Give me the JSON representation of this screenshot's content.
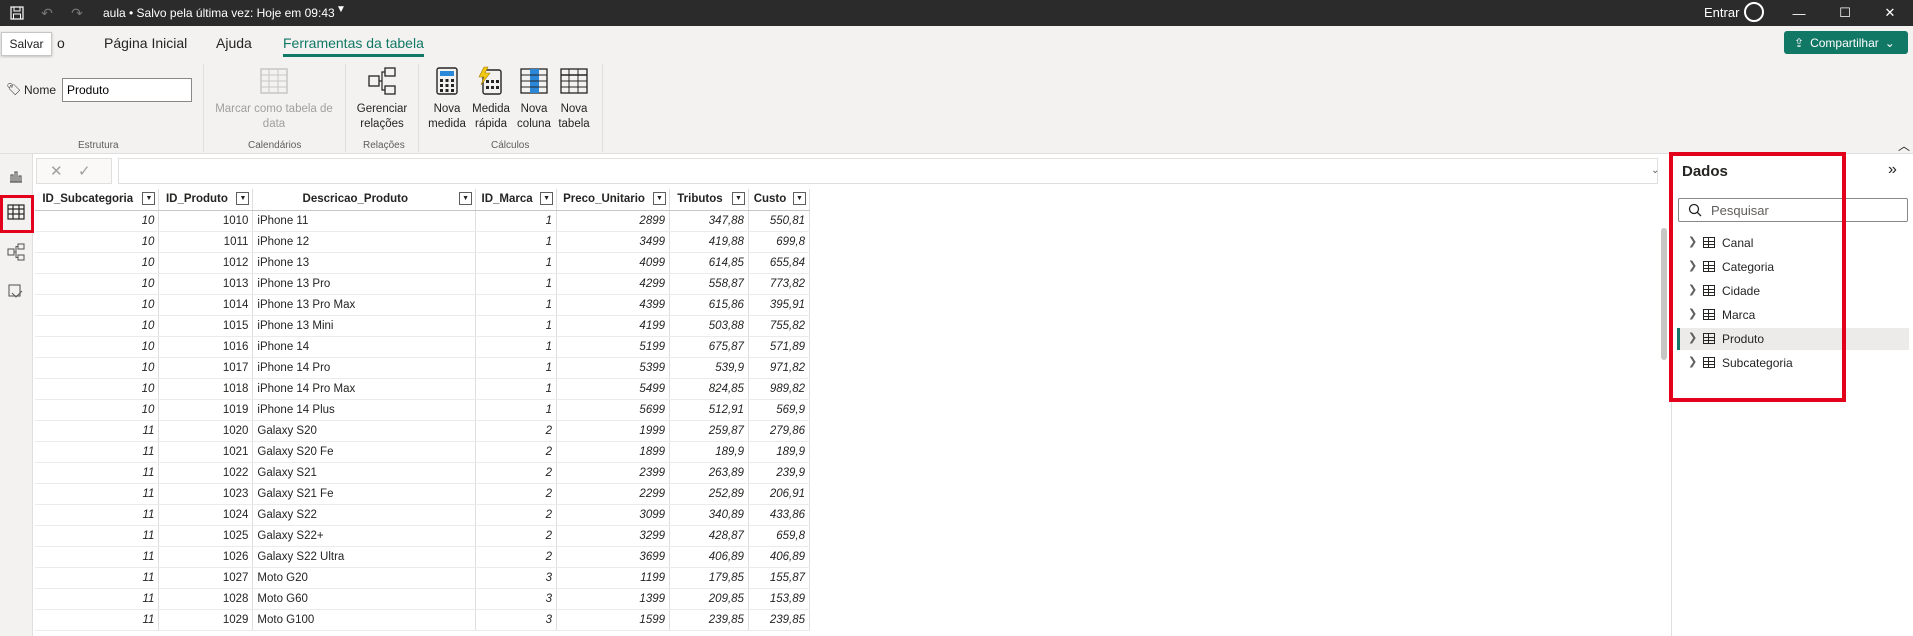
{
  "titlebar": {
    "title": "aula • Salvo pela última vez: Hoje em 09:43",
    "signin": "Entrar"
  },
  "tooltip": "Salvar",
  "tabs": [
    {
      "label": "o"
    },
    {
      "label": "Página Inicial"
    },
    {
      "label": "Ajuda"
    },
    {
      "label": "Ferramentas da tabela"
    }
  ],
  "share": {
    "label": "Compartilhar"
  },
  "ribbon": {
    "name_label": "Nome",
    "name_value": "Produto",
    "groups": {
      "estrutura": "Estrutura",
      "calendarios": "Calendários",
      "relacoes": "Relações",
      "calculos": "Cálculos"
    },
    "buttons": {
      "marcar": "Marcar como tabela de data",
      "gerenciar": "Gerenciar relações",
      "nova_medida": "Nova medida",
      "medida_rapida": "Medida rápida",
      "nova_coluna": "Nova coluna",
      "nova_tabela": "Nova tabela"
    }
  },
  "table": {
    "columns": [
      "ID_Subcategoria",
      "ID_Produto",
      "Descricao_Produto",
      "ID_Marca",
      "Preco_Unitario",
      "Tributos",
      "Custo"
    ],
    "rows": [
      [
        "10",
        "1010",
        "iPhone 11",
        "1",
        "2899",
        "347,88",
        "550,81"
      ],
      [
        "10",
        "1011",
        "iPhone 12",
        "1",
        "3499",
        "419,88",
        "699,8"
      ],
      [
        "10",
        "1012",
        "iPhone 13",
        "1",
        "4099",
        "614,85",
        "655,84"
      ],
      [
        "10",
        "1013",
        "iPhone 13 Pro",
        "1",
        "4299",
        "558,87",
        "773,82"
      ],
      [
        "10",
        "1014",
        "iPhone 13 Pro Max",
        "1",
        "4399",
        "615,86",
        "395,91"
      ],
      [
        "10",
        "1015",
        "iPhone 13 Mini",
        "1",
        "4199",
        "503,88",
        "755,82"
      ],
      [
        "10",
        "1016",
        "iPhone 14",
        "1",
        "5199",
        "675,87",
        "571,89"
      ],
      [
        "10",
        "1017",
        "iPhone 14 Pro",
        "1",
        "5399",
        "539,9",
        "971,82"
      ],
      [
        "10",
        "1018",
        "iPhone 14 Pro Max",
        "1",
        "5499",
        "824,85",
        "989,82"
      ],
      [
        "10",
        "1019",
        "iPhone 14 Plus",
        "1",
        "5699",
        "512,91",
        "569,9"
      ],
      [
        "11",
        "1020",
        "Galaxy S20",
        "2",
        "1999",
        "259,87",
        "279,86"
      ],
      [
        "11",
        "1021",
        "Galaxy S20 Fe",
        "2",
        "1899",
        "189,9",
        "189,9"
      ],
      [
        "11",
        "1022",
        "Galaxy S21",
        "2",
        "2399",
        "263,89",
        "239,9"
      ],
      [
        "11",
        "1023",
        "Galaxy S21 Fe",
        "2",
        "2299",
        "252,89",
        "206,91"
      ],
      [
        "11",
        "1024",
        "Galaxy S22",
        "2",
        "3099",
        "340,89",
        "433,86"
      ],
      [
        "11",
        "1025",
        "Galaxy S22+",
        "2",
        "3299",
        "428,87",
        "659,8"
      ],
      [
        "11",
        "1026",
        "Galaxy S22 Ultra",
        "2",
        "3699",
        "406,89",
        "406,89"
      ],
      [
        "11",
        "1027",
        "Moto G20",
        "3",
        "1199",
        "179,85",
        "155,87"
      ],
      [
        "11",
        "1028",
        "Moto G60",
        "3",
        "1399",
        "209,85",
        "153,89"
      ],
      [
        "11",
        "1029",
        "Moto G100",
        "3",
        "1599",
        "239,85",
        "239,85"
      ]
    ]
  },
  "data_panel": {
    "title": "Dados",
    "search_placeholder": "Pesquisar",
    "tables": [
      "Canal",
      "Categoria",
      "Cidade",
      "Marca",
      "Produto",
      "Subcategoria"
    ],
    "selected": "Produto"
  }
}
